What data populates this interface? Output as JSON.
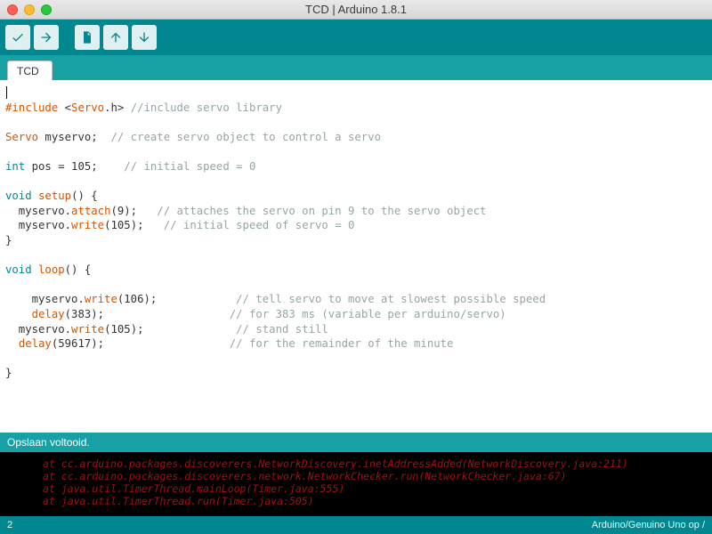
{
  "window": {
    "title": "TCD | Arduino 1.8.1"
  },
  "tabs": {
    "t0": "TCD"
  },
  "toolbar": {
    "verify": "verify-button",
    "upload": "upload-button",
    "new": "new-button",
    "open": "open-button",
    "save": "save-button"
  },
  "code": {
    "l1": "#include",
    "l1b": " <",
    "l1c": "Servo",
    "l1d": ".h> ",
    "l1e": "//include servo library",
    "l2a": "Servo",
    "l2b": " myservo;  ",
    "l2c": "// create servo object to control a servo",
    "l3a": "int",
    "l3b": " pos = 105;    ",
    "l3c": "// initial speed = 0",
    "l4a": "void",
    "l4b": " ",
    "l4c": "setup",
    "l4d": "() {",
    "l5a": "  myservo.",
    "l5b": "attach",
    "l5c": "(9);   ",
    "l5d": "// attaches the servo on pin 9 to the servo object",
    "l6a": "  myservo.",
    "l6b": "write",
    "l6c": "(105);   ",
    "l6d": "// initial speed of servo = 0",
    "l7": "}",
    "l8a": "void",
    "l8b": " ",
    "l8c": "loop",
    "l8d": "() {",
    "l9a": "    myservo.",
    "l9b": "write",
    "l9c": "(106);            ",
    "l9d": "// tell servo to move at slowest possible speed",
    "l10a": "    ",
    "l10b": "delay",
    "l10c": "(383);                   ",
    "l10d": "// for 383 ms (variable per arduino/servo)",
    "l11a": "  myservo.",
    "l11b": "write",
    "l11c": "(105);              ",
    "l11d": "// stand still",
    "l12a": "  ",
    "l12b": "delay",
    "l12c": "(59617);                   ",
    "l12d": "// for the remainder of the minute",
    "l13": "}"
  },
  "status": {
    "msg": "Opslaan voltooid."
  },
  "console": {
    "l1": "at cc.arduino.packages.discoverers.NetworkDiscovery.inetAddressAdded(NetworkDiscovery.java:211)",
    "l2": "at cc.arduino.packages.discoverers.network.NetworkChecker.run(NetworkChecker.java:67)",
    "l3": "at java.util.TimerThread.mainLoop(Timer.java:555)",
    "l4": "at java.util.TimerThread.run(Timer.java:505)"
  },
  "footer": {
    "left": "2",
    "right": "Arduino/Genuino Uno op /"
  }
}
